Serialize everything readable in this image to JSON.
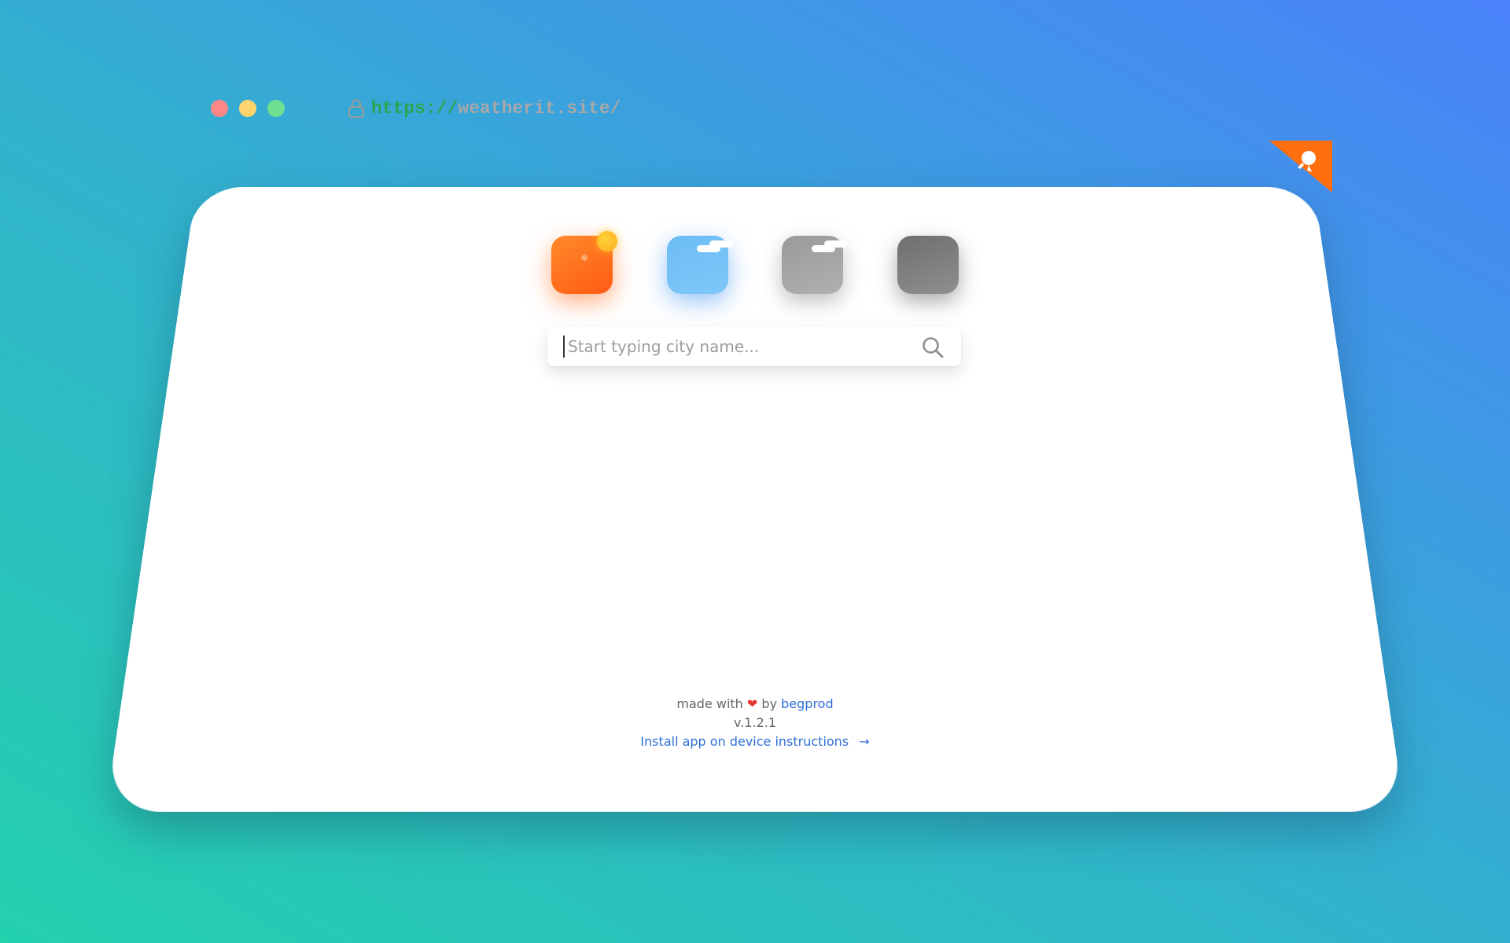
{
  "browser": {
    "url_scheme": "https://",
    "url_host": "weatherit.site/"
  },
  "weather_icons": [
    "sun-icon",
    "cloud-icon",
    "grey-cloud-icon",
    "dark-cloud-icon"
  ],
  "search": {
    "placeholder": "Start typing city name...",
    "value": ""
  },
  "footer": {
    "made_with": "made with",
    "heart": "❤",
    "by": "by",
    "author": "begprod",
    "version": "v.1.2.1",
    "install_link": "Install app on device instructions",
    "arrow": "→"
  },
  "colors": {
    "ribbon": "#ff6f0f",
    "link": "#2f6fd6",
    "url_scheme": "#2aa650"
  }
}
